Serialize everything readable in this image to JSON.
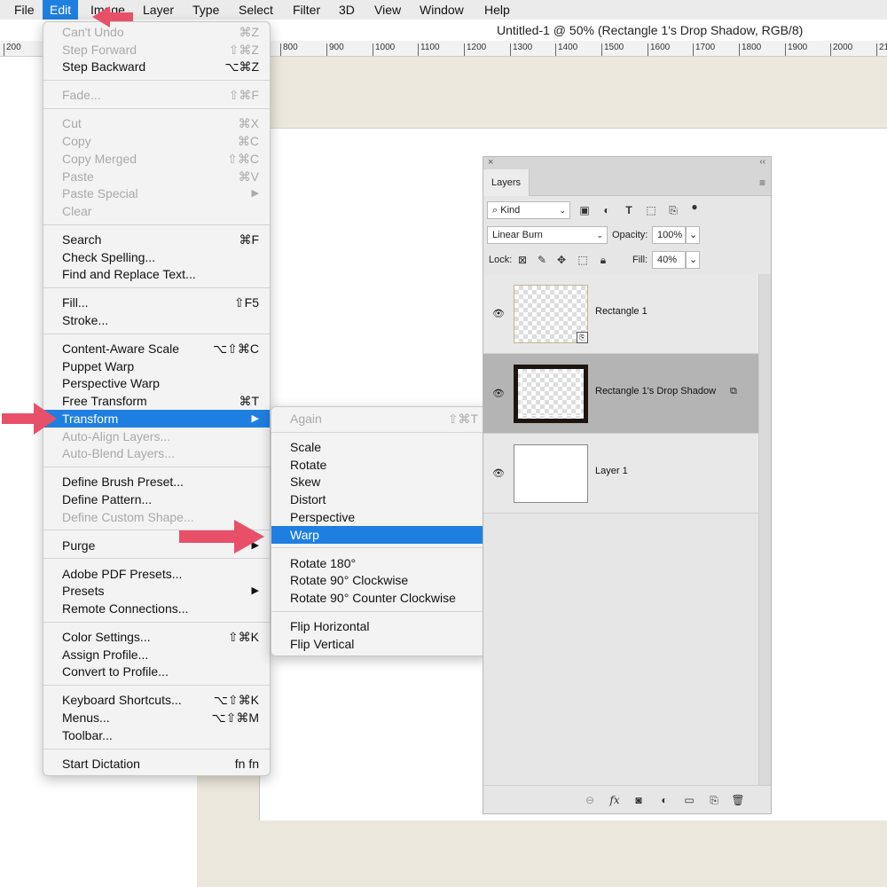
{
  "menubar": {
    "items": [
      "File",
      "Edit",
      "Image",
      "Layer",
      "Type",
      "Select",
      "Filter",
      "3D",
      "View",
      "Window",
      "Help"
    ],
    "active": "Edit"
  },
  "document": {
    "title": "Untitled-1 @ 50% (Rectangle 1's Drop Shadow, RGB/8)",
    "ruler_ticks": [
      "200",
      "800",
      "900",
      "1000",
      "1100",
      "1200",
      "1300",
      "1400",
      "1500",
      "1600",
      "1700",
      "1800",
      "1900",
      "2000",
      "21"
    ]
  },
  "edit_menu": {
    "groups": [
      [
        {
          "label": "Can't Undo",
          "shortcut": "⌘Z",
          "disabled": true
        },
        {
          "label": "Step Forward",
          "shortcut": "⇧⌘Z",
          "disabled": true
        },
        {
          "label": "Step Backward",
          "shortcut": "⌥⌘Z"
        }
      ],
      [
        {
          "label": "Fade...",
          "shortcut": "⇧⌘F",
          "disabled": true
        }
      ],
      [
        {
          "label": "Cut",
          "shortcut": "⌘X",
          "disabled": true
        },
        {
          "label": "Copy",
          "shortcut": "⌘C",
          "disabled": true
        },
        {
          "label": "Copy Merged",
          "shortcut": "⇧⌘C",
          "disabled": true
        },
        {
          "label": "Paste",
          "shortcut": "⌘V",
          "disabled": true
        },
        {
          "label": "Paste Special",
          "submenu": true,
          "disabled": true
        },
        {
          "label": "Clear",
          "disabled": true
        }
      ],
      [
        {
          "label": "Search",
          "shortcut": "⌘F"
        },
        {
          "label": "Check Spelling..."
        },
        {
          "label": "Find and Replace Text..."
        }
      ],
      [
        {
          "label": "Fill...",
          "shortcut": "⇧F5"
        },
        {
          "label": "Stroke..."
        }
      ],
      [
        {
          "label": "Content-Aware Scale",
          "shortcut": "⌥⇧⌘C"
        },
        {
          "label": "Puppet Warp"
        },
        {
          "label": "Perspective Warp"
        },
        {
          "label": "Free Transform",
          "shortcut": "⌘T"
        },
        {
          "label": "Transform",
          "submenu": true,
          "highlighted": true
        },
        {
          "label": "Auto-Align Layers...",
          "disabled": true
        },
        {
          "label": "Auto-Blend Layers...",
          "disabled": true
        }
      ],
      [
        {
          "label": "Define Brush Preset..."
        },
        {
          "label": "Define Pattern..."
        },
        {
          "label": "Define Custom Shape...",
          "disabled": true
        }
      ],
      [
        {
          "label": "Purge",
          "submenu": true
        }
      ],
      [
        {
          "label": "Adobe PDF Presets..."
        },
        {
          "label": "Presets",
          "submenu": true
        },
        {
          "label": "Remote Connections..."
        }
      ],
      [
        {
          "label": "Color Settings...",
          "shortcut": "⇧⌘K"
        },
        {
          "label": "Assign Profile..."
        },
        {
          "label": "Convert to Profile..."
        }
      ],
      [
        {
          "label": "Keyboard Shortcuts...",
          "shortcut": "⌥⇧⌘K"
        },
        {
          "label": "Menus...",
          "shortcut": "⌥⇧⌘M"
        },
        {
          "label": "Toolbar..."
        }
      ],
      [
        {
          "label": "Start Dictation",
          "shortcut": "fn fn"
        }
      ]
    ]
  },
  "transform_submenu": {
    "groups": [
      [
        {
          "label": "Again",
          "shortcut": "⇧⌘T",
          "disabled": true
        }
      ],
      [
        {
          "label": "Scale"
        },
        {
          "label": "Rotate"
        },
        {
          "label": "Skew"
        },
        {
          "label": "Distort"
        },
        {
          "label": "Perspective"
        },
        {
          "label": "Warp",
          "highlighted": true
        }
      ],
      [
        {
          "label": "Rotate 180°"
        },
        {
          "label": "Rotate 90° Clockwise"
        },
        {
          "label": "Rotate 90° Counter Clockwise"
        }
      ],
      [
        {
          "label": "Flip Horizontal"
        },
        {
          "label": "Flip Vertical"
        }
      ]
    ]
  },
  "layers_panel": {
    "tab": "Layers",
    "filter_kind": "Kind",
    "blend_mode": "Linear Burn",
    "opacity_label": "Opacity:",
    "opacity": "100%",
    "lock_label": "Lock:",
    "fill_label": "Fill:",
    "fill": "40%",
    "layers": [
      {
        "name": "Rectangle 1",
        "selected": false
      },
      {
        "name": "Rectangle 1's Drop Shadow",
        "selected": true
      },
      {
        "name": "Layer 1",
        "selected": false
      }
    ]
  },
  "colors": {
    "highlight": "#1f7fe0",
    "arrow": "#e8506a"
  }
}
